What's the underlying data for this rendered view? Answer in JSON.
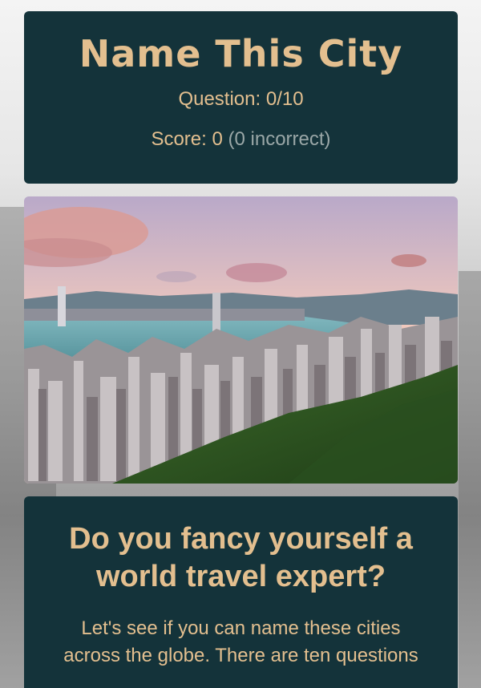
{
  "header": {
    "title": "Name This City",
    "question_label": "Question:",
    "question_value": "0/10",
    "score_label": "Score:",
    "score_value": "0",
    "incorrect_text": "(0 incorrect)"
  },
  "intro": {
    "heading": "Do you fancy yourself a world travel expert?",
    "text": "Let's see if you can name these cities across the globe. There are ten questions"
  },
  "colors": {
    "card_background": "#14333a",
    "accent": "#e3bf8f",
    "muted": "#9aa7a7"
  }
}
